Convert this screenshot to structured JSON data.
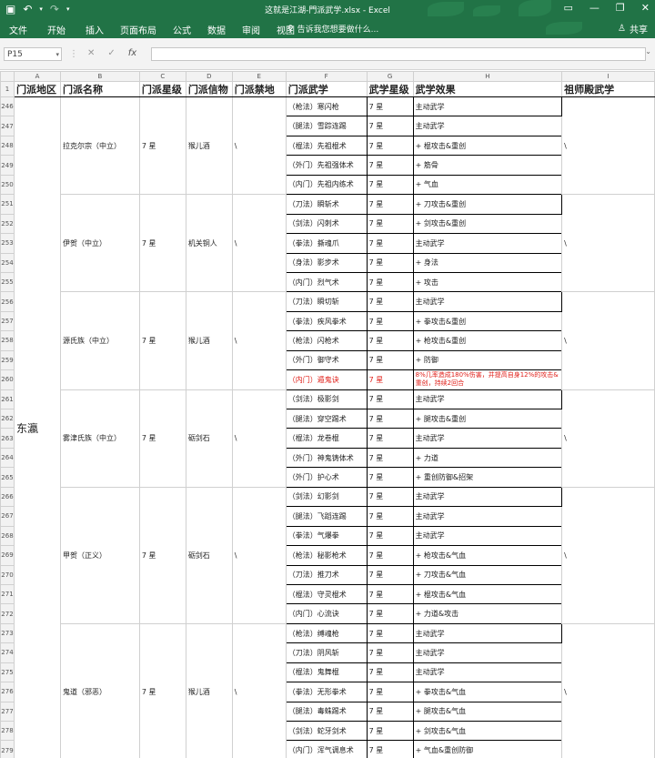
{
  "window": {
    "title": "这就是江湖-門派武学.xlsx - Excel",
    "controls": [
      "▭",
      "—",
      "❐",
      "✕"
    ]
  },
  "ribbon": {
    "tabs": [
      "文件",
      "开始",
      "插入",
      "页面布局",
      "公式",
      "数据",
      "审阅",
      "视图"
    ],
    "tell_me": "告诉我您想要做什么...",
    "share": "共享"
  },
  "formula_bar": {
    "name_box": "P15",
    "value": ""
  },
  "columns": [
    "A",
    "B",
    "C",
    "D",
    "E",
    "F",
    "G",
    "H",
    "I"
  ],
  "header_row": {
    "row_num": "1",
    "cells": [
      "门派地区",
      "门派名称",
      "门派星级",
      "门派信物",
      "门派禁地",
      "门派武学",
      "武学星级",
      "武学效果",
      "祖师殿武学"
    ]
  },
  "region": "东瀛",
  "sects": [
    {
      "name": "拉克尔宗（中立）",
      "star": "7 星",
      "item": "猴儿酒",
      "forbidden": "\\",
      "zushi": "\\",
      "rows": [
        {
          "row": "246",
          "wuxue": "（枪法）寒闪枪",
          "star": "7 星",
          "effect": "主动武学"
        },
        {
          "row": "247",
          "wuxue": "（腿法）雪踪连踢",
          "star": "7 星",
          "effect": "主动武学"
        },
        {
          "row": "248",
          "wuxue": "（棍法）先祖棍术",
          "star": "7 星",
          "effect": "+ 棍攻击&重创"
        },
        {
          "row": "249",
          "wuxue": "（外门）先祖强体术",
          "star": "7 星",
          "effect": "+ 筋骨"
        },
        {
          "row": "250",
          "wuxue": "（内门）先祖内练术",
          "star": "7 星",
          "effect": "+ 气血"
        }
      ]
    },
    {
      "name": "伊贺（中立）",
      "star": "7 星",
      "item": "机关铜人",
      "forbidden": "\\",
      "zushi": "\\",
      "rows": [
        {
          "row": "251",
          "wuxue": "（刀法）瞬斩术",
          "star": "7 星",
          "effect": "+ 刀攻击&重创"
        },
        {
          "row": "252",
          "wuxue": "（剑法）闪刺术",
          "star": "7 星",
          "effect": "+ 剑攻击&重创"
        },
        {
          "row": "253",
          "wuxue": "（拳法）撕魂爪",
          "star": "7 星",
          "effect": "主动武学"
        },
        {
          "row": "254",
          "wuxue": "（身法）影步术",
          "star": "7 星",
          "effect": "+ 身法"
        },
        {
          "row": "255",
          "wuxue": "（内门）烈气术",
          "star": "7 星",
          "effect": "+ 攻击"
        }
      ]
    },
    {
      "name": "源氏族（中立）",
      "star": "7 星",
      "item": "猴儿酒",
      "forbidden": "\\",
      "zushi": "\\",
      "rows": [
        {
          "row": "256",
          "wuxue": "（刀法）瞬切斩",
          "star": "7 星",
          "effect": "主动武学"
        },
        {
          "row": "257",
          "wuxue": "（拳法）疾风拳术",
          "star": "7 星",
          "effect": "+ 拳攻击&重创"
        },
        {
          "row": "258",
          "wuxue": "（枪法）闪枪术",
          "star": "7 星",
          "effect": "+ 枪攻击&重创"
        },
        {
          "row": "259",
          "wuxue": "（外门）御守术",
          "star": "7 星",
          "effect": "+ 防御"
        },
        {
          "row": "260",
          "wuxue": "（内门）遁鬼诀",
          "star": "7 星",
          "effect": "8%几率造成180%伤害，并提高自身12%的攻击&重创，持续2回合",
          "red": true
        }
      ]
    },
    {
      "name": "雾津氏族（中立）",
      "star": "7 星",
      "item": "砺剑石",
      "forbidden": "\\",
      "zushi": "\\",
      "rows": [
        {
          "row": "261",
          "wuxue": "（剑法）极影剑",
          "star": "7 星",
          "effect": "主动武学"
        },
        {
          "row": "262",
          "wuxue": "（腿法）穿空踢术",
          "star": "7 星",
          "effect": "+ 腿攻击&重创"
        },
        {
          "row": "263",
          "wuxue": "（棍法）龙卷棍",
          "star": "7 星",
          "effect": "主动武学"
        },
        {
          "row": "264",
          "wuxue": "（外门）神鬼铸体术",
          "star": "7 星",
          "effect": "+ 力道"
        },
        {
          "row": "265",
          "wuxue": "（外门）护心术",
          "star": "7 星",
          "effect": "+ 重创防御&招架"
        }
      ]
    },
    {
      "name": "甲贺（正义）",
      "star": "7 星",
      "item": "砺剑石",
      "forbidden": "\\",
      "zushi": "\\",
      "rows": [
        {
          "row": "266",
          "wuxue": "（剑法）幻影剑",
          "star": "7 星",
          "effect": "主动武学"
        },
        {
          "row": "267",
          "wuxue": "（腿法）飞蹈连踢",
          "star": "7 星",
          "effect": "主动武学"
        },
        {
          "row": "268",
          "wuxue": "（拳法）气爆拳",
          "star": "7 星",
          "effect": "主动武学"
        },
        {
          "row": "269",
          "wuxue": "（枪法）秘影枪术",
          "star": "7 星",
          "effect": "+ 枪攻击&气血"
        },
        {
          "row": "270",
          "wuxue": "（刀法）推刀术",
          "star": "7 星",
          "effect": "+ 刀攻击&气血"
        },
        {
          "row": "271",
          "wuxue": "（棍法）守灵棍术",
          "star": "7 星",
          "effect": "+ 棍攻击&气血"
        },
        {
          "row": "272",
          "wuxue": "（内门）心流诀",
          "star": "7 星",
          "effect": "+ 力道&攻击"
        }
      ]
    },
    {
      "name": "鬼道（邪恶）",
      "star": "7 星",
      "item": "猴儿酒",
      "forbidden": "\\",
      "zushi": "\\",
      "rows": [
        {
          "row": "273",
          "wuxue": "（枪法）缚魂枪",
          "star": "7 星",
          "effect": "主动武学"
        },
        {
          "row": "274",
          "wuxue": "（刀法）阴风斩",
          "star": "7 星",
          "effect": "主动武学"
        },
        {
          "row": "275",
          "wuxue": "（棍法）鬼舞棍",
          "star": "7 星",
          "effect": "主动武学"
        },
        {
          "row": "276",
          "wuxue": "（拳法）无形拳术",
          "star": "7 星",
          "effect": "+ 拳攻击&气血"
        },
        {
          "row": "277",
          "wuxue": "（腿法）毒蛛踢术",
          "star": "7 星",
          "effect": "+ 腿攻击&气血"
        },
        {
          "row": "278",
          "wuxue": "（剑法）蛇牙剑术",
          "star": "7 星",
          "effect": "+ 剑攻击&气血"
        },
        {
          "row": "279",
          "wuxue": "（内门）浑气调息术",
          "star": "7 星",
          "effect": "+ 气血&重创防御"
        }
      ]
    }
  ]
}
